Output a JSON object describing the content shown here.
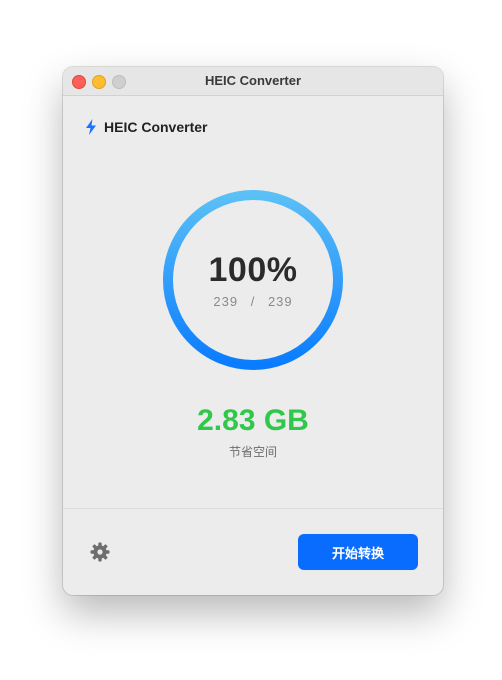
{
  "window": {
    "title": "HEIC Converter"
  },
  "header": {
    "app_name": "HEIC Converter",
    "icon": "bolt-icon"
  },
  "progress": {
    "percent_label": "100%",
    "done": "239",
    "separator": "/",
    "total": "239",
    "fraction": 1.0,
    "gradient_start": "#0a7cff",
    "gradient_end": "#5ac0f6"
  },
  "savings": {
    "value": "2.83 GB",
    "label": "节省空间",
    "color": "#2fc84a"
  },
  "footer": {
    "settings_icon": "gear-icon",
    "start_label": "开始转换",
    "accent": "#0a6cff"
  }
}
